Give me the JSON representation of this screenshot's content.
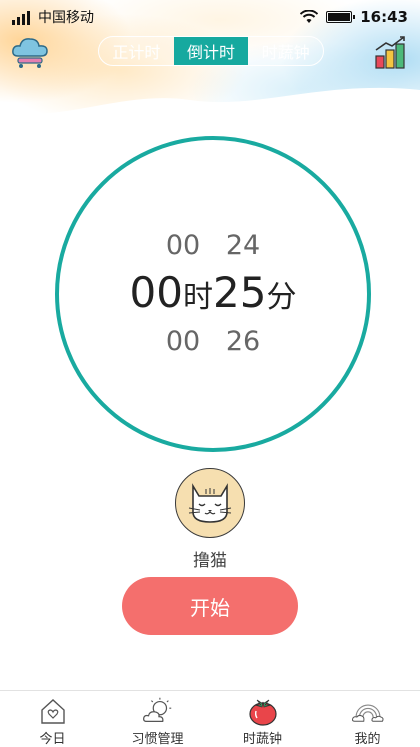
{
  "status": {
    "carrier": "中国移动",
    "time": "16:43"
  },
  "header": {
    "tabs": [
      {
        "label": "正计时",
        "active": false
      },
      {
        "label": "倒计时",
        "active": true
      },
      {
        "label": "时蔬钟",
        "active": false
      }
    ],
    "left_icon": "cloud-sync-icon",
    "right_icon": "stats-chart-icon"
  },
  "timer": {
    "prev": {
      "hour": "00",
      "minute": "24"
    },
    "current": {
      "hour": "00",
      "hour_unit": "时",
      "minute": "25",
      "minute_unit": "分"
    },
    "next": {
      "hour": "00",
      "minute": "26"
    }
  },
  "companion": {
    "name": "撸猫",
    "icon": "cat-icon"
  },
  "start_button": "开始",
  "nav": [
    {
      "label": "今日",
      "icon": "home-heart-icon"
    },
    {
      "label": "习惯管理",
      "icon": "sun-cloud-icon"
    },
    {
      "label": "时蔬钟",
      "icon": "tomato-icon"
    },
    {
      "label": "我的",
      "icon": "rainbow-cloud-icon"
    }
  ],
  "colors": {
    "accent": "#16a99f",
    "start": "#f46f6d",
    "cat_bg": "#f6dfb0"
  }
}
